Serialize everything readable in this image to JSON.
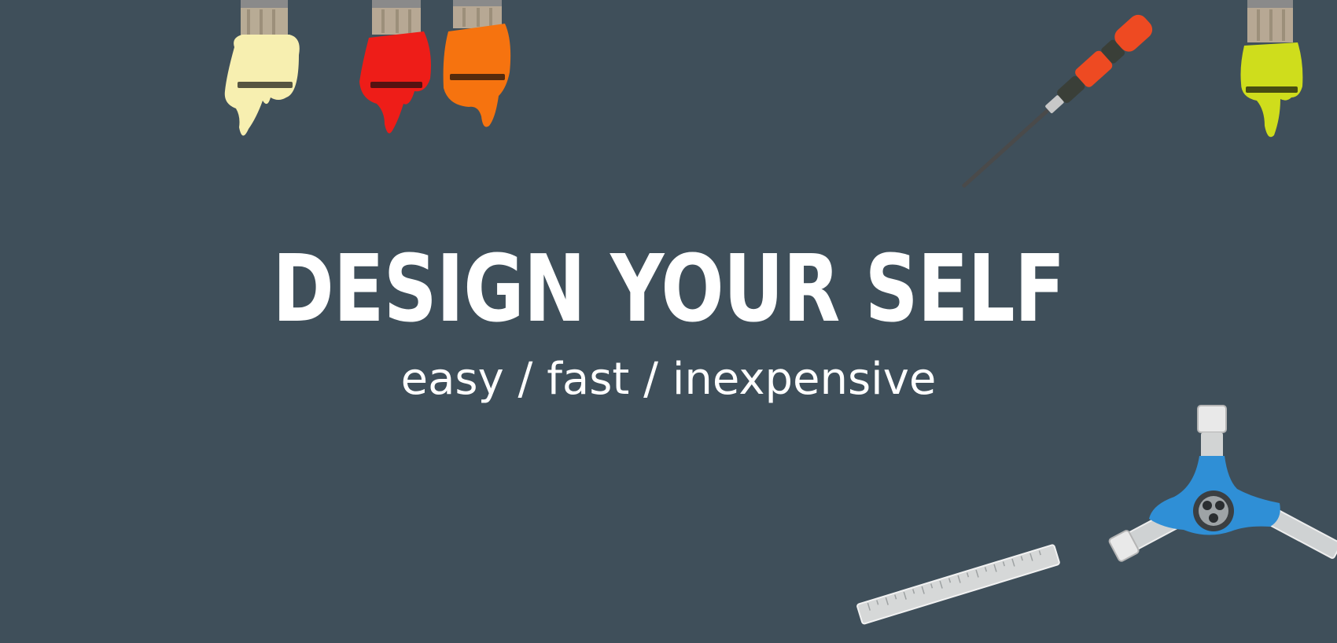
{
  "hero": {
    "headline": "DESIGN YOUR SELF",
    "tagline": "easy / fast / inexpensive"
  },
  "colors": {
    "background": "#3f4f5a",
    "text": "#ffffff",
    "paint_cream": "#f7efb0",
    "paint_red": "#ee1d18",
    "paint_orange": "#f6730f",
    "paint_lime": "#cfdd1c",
    "screwdriver_handle": "#ee4a22",
    "tool_blue": "#2f8fd6"
  },
  "decorations": [
    {
      "icon": "paintbrush-cream-icon"
    },
    {
      "icon": "paintbrush-red-icon"
    },
    {
      "icon": "paintbrush-orange-icon"
    },
    {
      "icon": "paintbrush-lime-icon"
    },
    {
      "icon": "screwdriver-icon"
    },
    {
      "icon": "ruler-icon"
    },
    {
      "icon": "socket-wrench-icon"
    }
  ]
}
